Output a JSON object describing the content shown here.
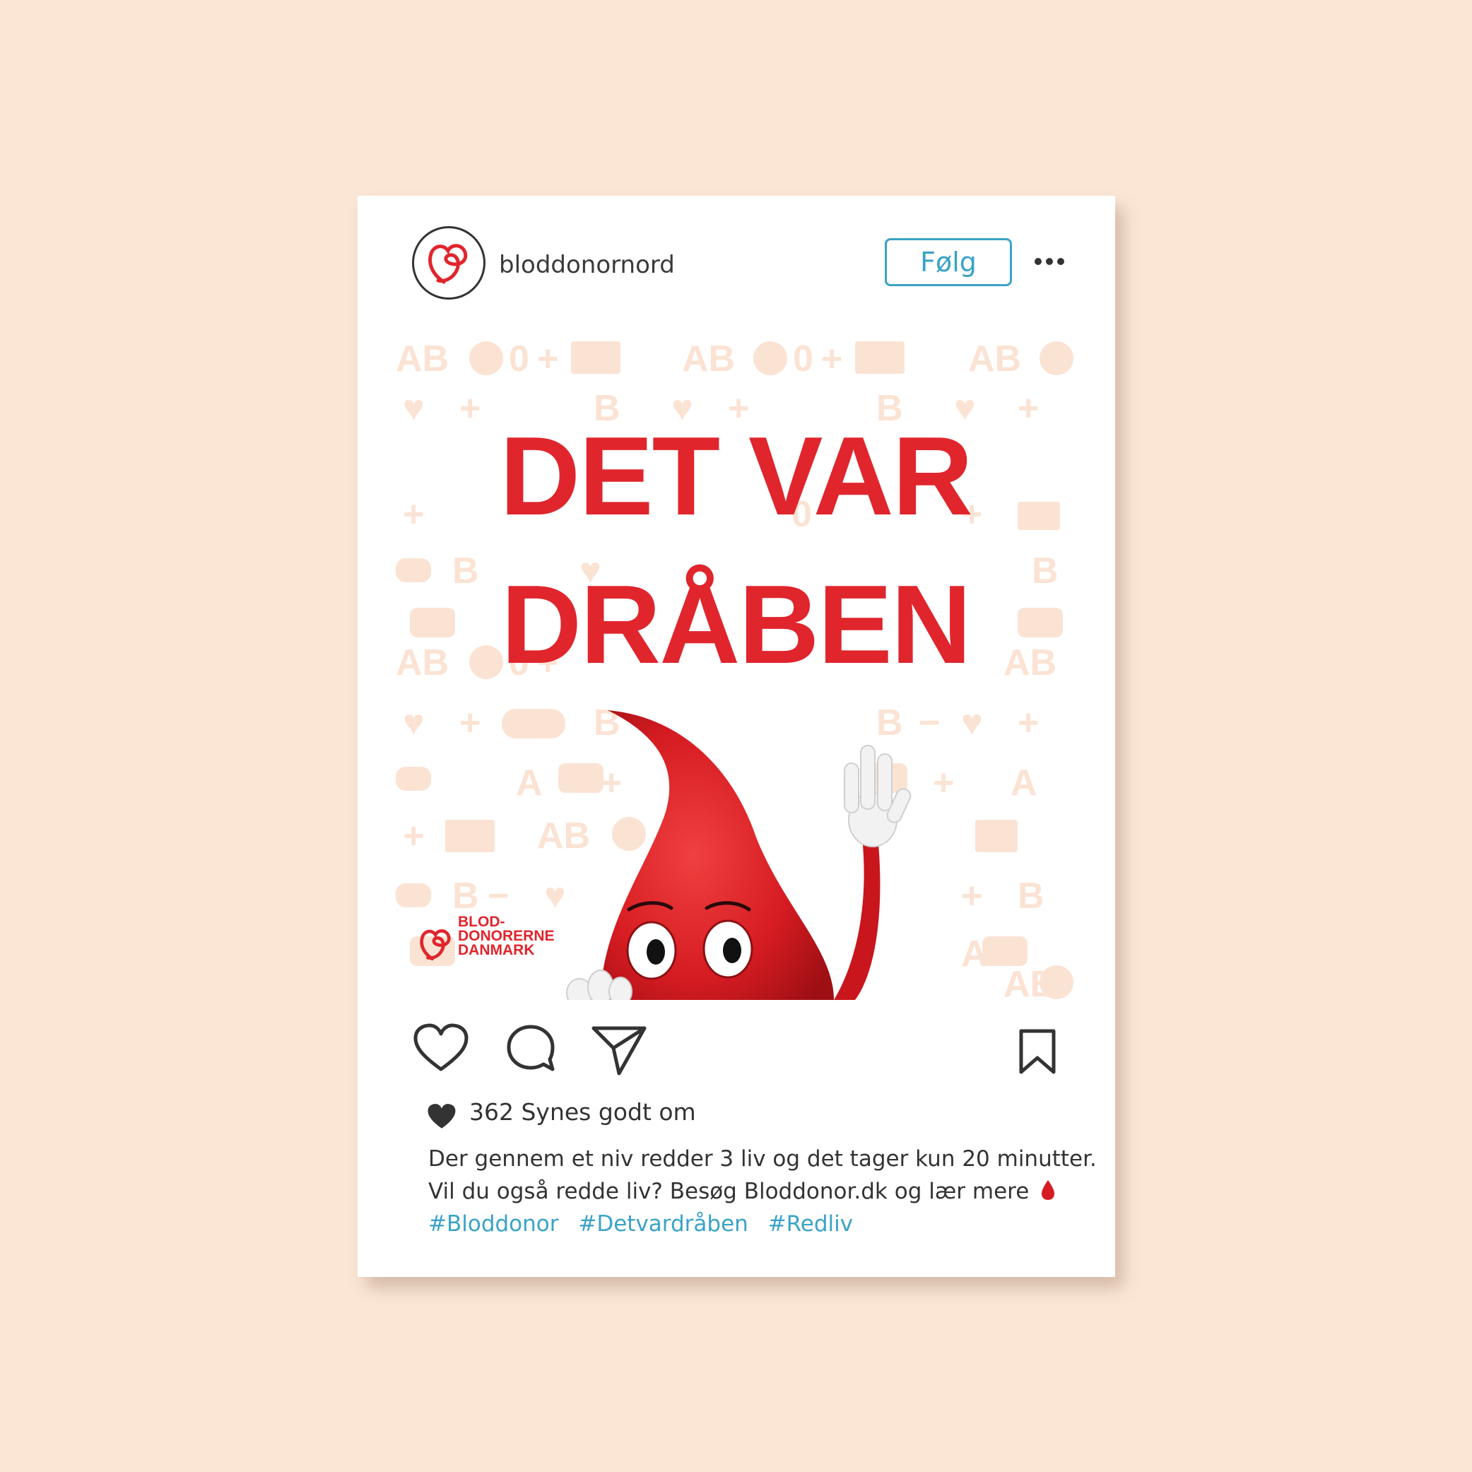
{
  "profile": {
    "username": "bloddonornord",
    "follow_label": "Følg"
  },
  "post": {
    "headline_line1": "DET VAR",
    "headline_line2": "DRÅBEN",
    "brand_lines": [
      "BLOD-",
      "DONORERNE",
      "DANMARK"
    ],
    "likes_text": "362 Synes godt om",
    "caption_line1": "Der gennem et niv redder 3 liv og det tager kun 20 minutter.",
    "caption_line2": "Vil du også redde liv? Besøg Bloddonor.dk og lær mere",
    "hashtags": [
      "#Bloddonor",
      "#Detvardråben",
      "#Redliv"
    ]
  },
  "colors": {
    "page_background": "#fbe6d6",
    "brand_red": "#e0252c",
    "link_blue": "#3aa3c6",
    "pattern": "#fbe3d4"
  },
  "icons": [
    "heart-icon",
    "comment-icon",
    "send-icon",
    "bookmark-icon",
    "more-icon",
    "blood-drop-icon"
  ]
}
